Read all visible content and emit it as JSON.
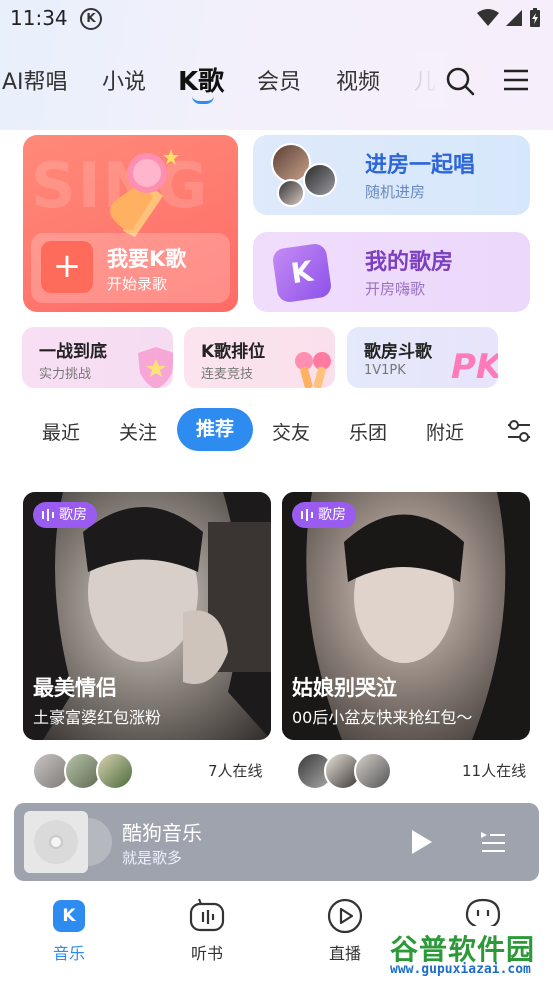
{
  "status_bar": {
    "time": "11:34",
    "app_icon": "K"
  },
  "nav": {
    "tabs": [
      "AI帮唱",
      "小说",
      "K歌",
      "会员",
      "视频",
      "儿"
    ],
    "active": "K歌"
  },
  "feature_cards": {
    "sing": {
      "bg_text": "SING",
      "title": "我要K歌",
      "subtitle": "开始录歌",
      "plus": "+"
    },
    "join_room": {
      "title": "进房一起唱",
      "subtitle": "随机进房"
    },
    "my_room": {
      "title": "我的歌房",
      "subtitle": "开房嗨歌",
      "badge": "K"
    }
  },
  "mini_cards": [
    {
      "title": "一战到底",
      "subtitle": "实力挑战"
    },
    {
      "title": "K歌排位",
      "subtitle": "连麦竞技"
    },
    {
      "title": "歌房斗歌",
      "subtitle": "1V1PK",
      "badge": "PK"
    }
  ],
  "filters": {
    "items": [
      "最近",
      "关注",
      "推荐",
      "交友",
      "乐团",
      "附近"
    ],
    "active": "推荐"
  },
  "rooms": [
    {
      "tag": "歌房",
      "title": "最美情侣",
      "subtitle": "土豪富婆红包涨粉",
      "online": "7人在线"
    },
    {
      "tag": "歌房",
      "title": "姑娘别哭泣",
      "subtitle": "00后小盆友快来抢红包～",
      "online": "11人在线"
    }
  ],
  "player": {
    "title": "酷狗音乐",
    "subtitle": "就是歌多"
  },
  "bottom_nav": [
    {
      "label": "音乐",
      "active": true,
      "icon": "K"
    },
    {
      "label": "听书"
    },
    {
      "label": "直播"
    },
    {
      "label": ""
    }
  ],
  "watermark": {
    "name": "谷普软件园",
    "url": "www.gupuxiazai.com"
  },
  "colors": {
    "accent": "#2e8bf0",
    "sing_card": "#ff7a6e",
    "room_blue": "#2c66d8",
    "room_purple": "#7b3fc0",
    "tag_purple": "#9a5cf0"
  }
}
